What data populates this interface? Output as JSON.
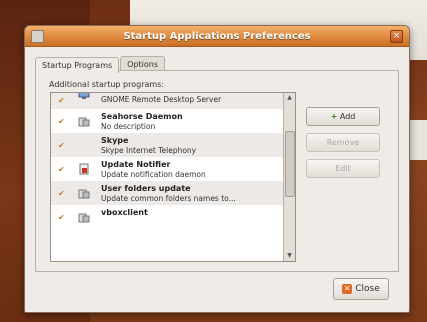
{
  "window": {
    "title": "Startup Applications Preferences"
  },
  "tabs": [
    {
      "label": "Startup Programs"
    },
    {
      "label": "Options"
    }
  ],
  "section_label": "Additional startup programs:",
  "programs": [
    {
      "name": "",
      "description": "GNOME Remote Desktop Server",
      "checked": true,
      "icon": "network-icon"
    },
    {
      "name": "Seahorse Daemon",
      "description": "No description",
      "checked": true,
      "icon": "app-icon"
    },
    {
      "name": "Skype",
      "description": "Skype Internet Telephony",
      "checked": true,
      "icon": ""
    },
    {
      "name": "Update Notifier",
      "description": "Update notification daemon",
      "checked": true,
      "icon": "update-icon"
    },
    {
      "name": "User folders update",
      "description": "Update common folders names to...",
      "checked": true,
      "icon": "app-icon"
    },
    {
      "name": "vboxclient",
      "description": "",
      "checked": true,
      "icon": "app-icon"
    }
  ],
  "buttons": {
    "add": "Add",
    "remove": "Remove",
    "edit": "Edit",
    "close": "Close"
  }
}
